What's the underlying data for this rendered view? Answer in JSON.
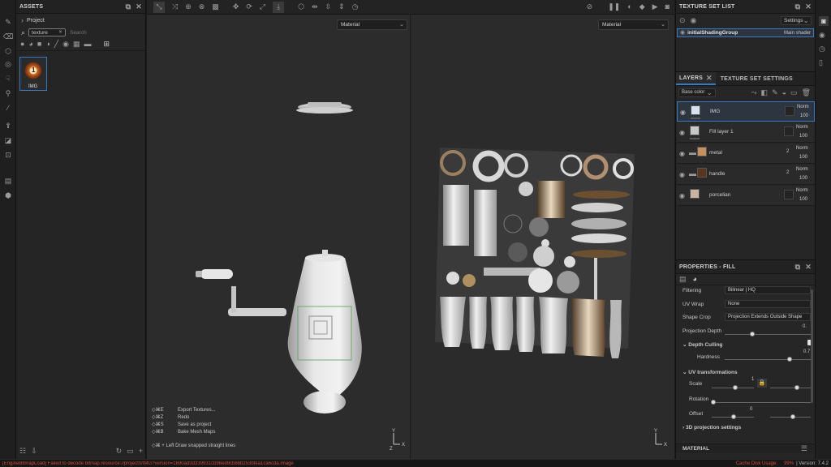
{
  "left_tools": [
    "brush-icon",
    "eraser-icon",
    "projection-icon",
    "geometry-mask-icon",
    "smudge-icon",
    "clone-icon",
    "picker-icon",
    "bake-icon",
    "polygon-fill-icon",
    "export-icon",
    "doc-icon",
    "cube-icon"
  ],
  "assets": {
    "title": "ASSETS",
    "tree_root": "Project",
    "search_value": "texture",
    "search_placeholder": "Search",
    "item": {
      "label": "IMG",
      "badge": "1"
    }
  },
  "viewport": {
    "material_left": "Material",
    "material_right": "Material",
    "shortcuts": [
      {
        "key": "◇⌘E",
        "label": "Export Textures..."
      },
      {
        "key": "◇⌘Z",
        "label": "Redo"
      },
      {
        "key": "◇⌘S",
        "label": "Save as project"
      },
      {
        "key": "◇⌘B",
        "label": "Bake Mesh Maps"
      }
    ],
    "hint": "◇⌘ + Left  Draw snapped straight lines",
    "axis_labels": {
      "x": "X",
      "y": "Y",
      "z": "Z"
    }
  },
  "texture_set_list": {
    "title": "TEXTURE SET LIST",
    "settings_label": "Settings",
    "entry_name": "initialShadingGroup",
    "entry_shader": "Main shader"
  },
  "layers_panel": {
    "tab_layers": "LAYERS",
    "tab_settings": "TEXTURE SET SETTINGS",
    "channel": "Base color",
    "items": [
      {
        "name": "IMG",
        "blend": "Norm",
        "opacity": "100",
        "thumb": "#d8e2ee",
        "selected": true
      },
      {
        "name": "Fill layer 1",
        "blend": "Norm",
        "opacity": "100",
        "thumb": "#c8c8c8",
        "selected": false
      },
      {
        "name": "metal",
        "blend": "Norm",
        "opacity": "100",
        "thumb": "#c49060",
        "selected": false,
        "count": "2"
      },
      {
        "name": "handle",
        "blend": "Norm",
        "opacity": "100",
        "thumb": "#5a3520",
        "selected": false,
        "count": "2"
      },
      {
        "name": "porcelian",
        "blend": "Norm",
        "opacity": "100",
        "thumb": "#c8b4a0",
        "selected": false
      }
    ]
  },
  "properties": {
    "title": "PROPERTIES - FILL",
    "filtering_label": "Filtering",
    "filtering_value": "Bilinear | HQ",
    "uvwrap_label": "UV Wrap",
    "uvwrap_value": "None",
    "shapecrop_label": "Shape Crop",
    "shapecrop_value": "Projection Extends Outside Shape",
    "projdepth_label": "Projection Depth",
    "projdepth_value": "0.",
    "depthculling_label": "Depth Culling",
    "hardness_label": "Hardness",
    "hardness_value": "0.7",
    "uvtrans_label": "UV transformations",
    "scale_label": "Scale",
    "scale_value": "1",
    "rotation_label": "Rotation",
    "offset_label": "Offset",
    "offset_value": "0",
    "proj3d_label": "3D projection settings",
    "material_section": "MATERIAL"
  },
  "status": {
    "error": "[EngineBitmapLoad] Failed to decode bitmap.resource://project0/IMG?version=1690ad3d339931cb98ed9cb8bb253bfea1ca6cda.image",
    "cache_label": "Cache Disk Usage:",
    "cache_value": "99%",
    "version": "| Version: 7.4.2"
  },
  "colors": {
    "accent": "#3b78c2",
    "error": "#d24a3a",
    "panel": "#262626"
  }
}
